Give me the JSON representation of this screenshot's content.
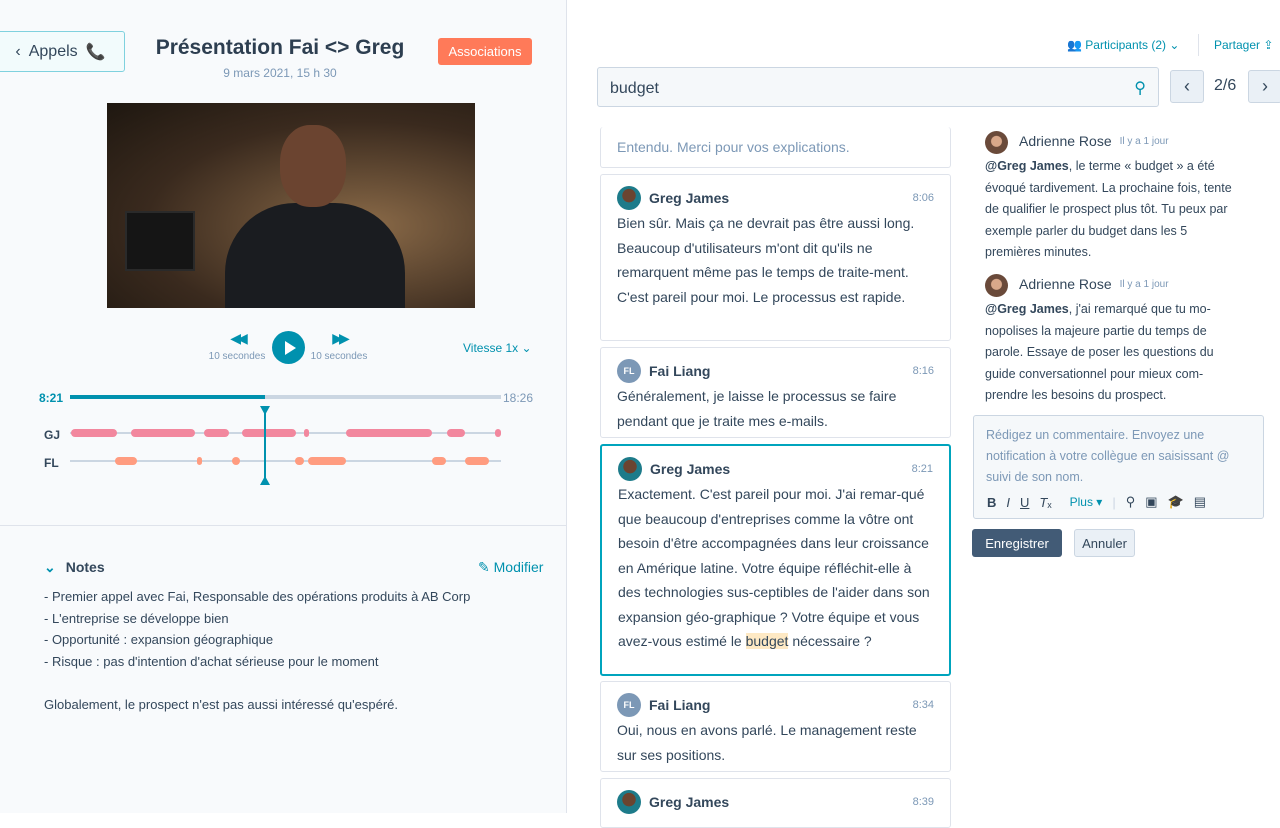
{
  "header": {
    "back_label": "Appels",
    "title": "Présentation Fai <> Greg",
    "date": "9 mars 2021, 15 h 30",
    "associations_label": "Associations"
  },
  "player": {
    "rewind_label": "10 secondes",
    "forward_label": "10 secondes",
    "speed_label": "Vitesse 1x",
    "current_time": "8:21",
    "total_time": "18:26",
    "progress_fraction": 0.453
  },
  "timeline": {
    "speakers": [
      {
        "label": "GJ",
        "color": "#f2879e",
        "segments_min": [
          [
            0.04,
            2.0
          ],
          [
            2.6,
            5.35
          ],
          [
            5.73,
            6.8
          ],
          [
            7.35,
            9.66
          ],
          [
            10.0,
            10.2
          ],
          [
            11.8,
            15.5
          ],
          [
            16.1,
            16.9
          ],
          [
            18.17,
            18.43
          ]
        ]
      },
      {
        "label": "FL",
        "color": "#ff9c80",
        "segments_min": [
          [
            1.92,
            2.86
          ],
          [
            5.43,
            5.56
          ],
          [
            6.93,
            7.27
          ],
          [
            9.62,
            10.0
          ],
          [
            10.18,
            11.8
          ],
          [
            15.48,
            16.08
          ],
          [
            16.89,
            17.92
          ]
        ]
      }
    ],
    "total_min": 18.43,
    "playhead_min": 8.35
  },
  "notes": {
    "title": "Notes",
    "edit_label": "Modifier",
    "lines": [
      "- Premier appel avec Fai, Responsable des opérations produits à AB Corp",
      "- L'entreprise se développe bien",
      "- Opportunité : expansion géographique",
      "- Risque : pas d'intention d'achat sérieuse pour le moment",
      "",
      "Globalement, le prospect n'est pas aussi intéressé qu'espéré."
    ]
  },
  "topbar": {
    "participants_label": "Participants (2)",
    "share_label": "Partager"
  },
  "search": {
    "value": "budget",
    "result_count": "2/6"
  },
  "transcript": [
    {
      "text": "Entendu. Merci pour vos explications."
    },
    {
      "speaker": "Greg James",
      "initials": "GJ",
      "time": "8:06",
      "text": "Bien sûr. Mais ça ne devrait pas être aussi long. Beaucoup d'utilisateurs m'ont dit qu'ils ne remarquent même pas le temps de traite-ment. C'est pareil pour moi. Le processus est rapide."
    },
    {
      "speaker": "Fai Liang",
      "initials": "FL",
      "time": "8:16",
      "text": "Généralement, je laisse le processus se faire pendant que je traite mes e-mails."
    },
    {
      "speaker": "Greg James",
      "initials": "GJ",
      "time": "8:21",
      "text_before": "Exactement. C'est pareil pour moi. J'ai remar-qué que beaucoup d'entreprises comme la vôtre ont besoin d'être accompagnées dans leur croissance en Amérique latine. Votre équipe réfléchit-elle à des technologies sus-ceptibles de l'aider dans son expansion géo-graphique ? Votre équipe et vous avez-vous estimé le ",
      "highlight": "budget",
      "text_after": " nécessaire ?"
    },
    {
      "speaker": "Fai Liang",
      "initials": "FL",
      "time": "8:34",
      "text": "Oui, nous en avons parlé. Le management reste sur ses positions."
    },
    {
      "speaker": "Greg James",
      "initials": "GJ",
      "time": "8:39",
      "text": ""
    }
  ],
  "comments": [
    {
      "author": "Adrienne Rose",
      "time": "Il y a 1 jour",
      "mention": "@Greg James",
      "text": ", le terme « budget » a été évoqué tardivement. La prochaine fois, tente de qualifier le prospect plus tôt. Tu peux par exemple parler du budget dans les 5 premières minutes."
    },
    {
      "author": "Adrienne Rose",
      "time": "Il y a 1 jour",
      "mention": "@Greg James",
      "text": ", j'ai remarqué que tu mo-nopolises la majeure partie du temps de parole. Essaye de poser les questions du guide conversationnel pour mieux com-prendre les besoins du prospect."
    }
  ],
  "editor": {
    "placeholder": "Rédigez un commentaire. Envoyez une notification à votre collègue en saisissant @ suivi de son nom.",
    "more_label": "Plus ▾",
    "save_label": "Enregistrer",
    "cancel_label": "Annuler"
  }
}
